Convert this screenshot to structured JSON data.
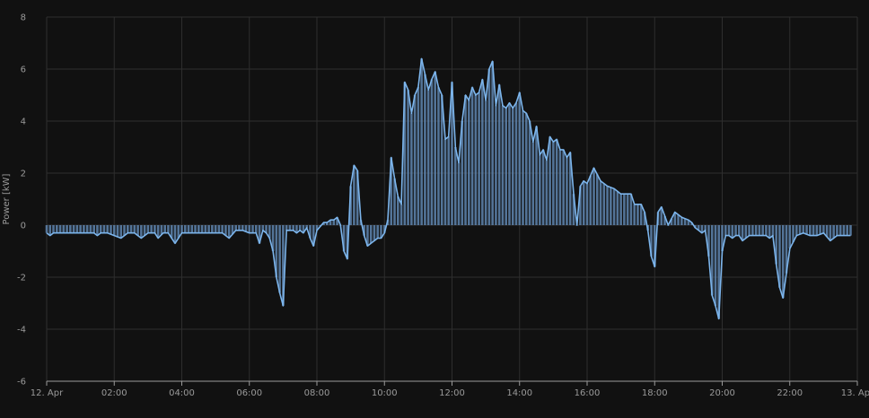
{
  "chart_data": {
    "type": "line",
    "title": "",
    "xlabel": "",
    "ylabel": "Power [kW]",
    "ylim": [
      -6,
      8
    ],
    "yticks": [
      -6,
      -4,
      -2,
      0,
      2,
      4,
      6,
      8
    ],
    "xlim": [
      0,
      24
    ],
    "xtick_labels": [
      "12. Apr",
      "02:00",
      "04:00",
      "06:00",
      "08:00",
      "10:00",
      "12:00",
      "14:00",
      "16:00",
      "18:00",
      "20:00",
      "22:00",
      "13. Apr"
    ],
    "xtick_hours": [
      0,
      2,
      4,
      6,
      8,
      10,
      12,
      14,
      16,
      18,
      20,
      22,
      24
    ],
    "grid": true,
    "colors": {
      "background": "#111111",
      "grid": "#2e2e2e",
      "line": "#7cb5ec",
      "bars": "#5f86b0"
    },
    "series": [
      {
        "x_hours": [
          0,
          0.1,
          0.2,
          0.4,
          0.6,
          0.8,
          1.0,
          1.2,
          1.4,
          1.5,
          1.6,
          1.8,
          2.0,
          2.2,
          2.4,
          2.6,
          2.8,
          3.0,
          3.2,
          3.3,
          3.45,
          3.6,
          3.8,
          4.0,
          4.2,
          4.4,
          4.6,
          4.8,
          5.0,
          5.2,
          5.4,
          5.6,
          5.8,
          6.0,
          6.1,
          6.2,
          6.3,
          6.4,
          6.5,
          6.6,
          6.7,
          6.8,
          6.9,
          7.0,
          7.1,
          7.2,
          7.3,
          7.4,
          7.5,
          7.6,
          7.7,
          7.8,
          7.9,
          8.0,
          8.2,
          8.3,
          8.4,
          8.5,
          8.6,
          8.7,
          8.8,
          8.9,
          9.0,
          9.1,
          9.2,
          9.3,
          9.4,
          9.5,
          9.6,
          9.7,
          9.8,
          9.9,
          10.0,
          10.1,
          10.2,
          10.3,
          10.4,
          10.5,
          10.6,
          10.7,
          10.8,
          10.9,
          11.0,
          11.1,
          11.2,
          11.3,
          11.4,
          11.5,
          11.6,
          11.7,
          11.8,
          11.9,
          12.0,
          12.1,
          12.2,
          12.3,
          12.4,
          12.5,
          12.6,
          12.7,
          12.8,
          12.9,
          13.0,
          13.1,
          13.2,
          13.3,
          13.4,
          13.5,
          13.6,
          13.7,
          13.8,
          13.9,
          14.0,
          14.1,
          14.2,
          14.3,
          14.4,
          14.5,
          14.6,
          14.7,
          14.8,
          14.9,
          15.0,
          15.1,
          15.2,
          15.3,
          15.4,
          15.5,
          15.6,
          15.7,
          15.8,
          15.9,
          16.0,
          16.2,
          16.4,
          16.6,
          16.8,
          17.0,
          17.1,
          17.2,
          17.3,
          17.4,
          17.5,
          17.6,
          17.7,
          17.8,
          17.9,
          18.0,
          18.1,
          18.2,
          18.4,
          18.6,
          18.8,
          19.0,
          19.1,
          19.2,
          19.3,
          19.4,
          19.5,
          19.6,
          19.7,
          19.8,
          19.9,
          20.0,
          20.1,
          20.2,
          20.3,
          20.4,
          20.5,
          20.6,
          20.8,
          21.0,
          21.2,
          21.3,
          21.4,
          21.5,
          21.6,
          21.7,
          21.8,
          22.0,
          22.2,
          22.4,
          22.6,
          22.8,
          23.0,
          23.2,
          23.4,
          23.6,
          23.7,
          23.8
        ],
        "values": [
          -0.3,
          -0.4,
          -0.3,
          -0.3,
          -0.3,
          -0.3,
          -0.3,
          -0.3,
          -0.3,
          -0.4,
          -0.3,
          -0.3,
          -0.4,
          -0.5,
          -0.3,
          -0.3,
          -0.5,
          -0.3,
          -0.3,
          -0.5,
          -0.3,
          -0.3,
          -0.7,
          -0.3,
          -0.3,
          -0.3,
          -0.3,
          -0.3,
          -0.3,
          -0.3,
          -0.5,
          -0.2,
          -0.2,
          -0.3,
          -0.3,
          -0.3,
          -0.7,
          -0.2,
          -0.3,
          -0.5,
          -1.0,
          -2.0,
          -2.6,
          -3.1,
          -0.2,
          -0.2,
          -0.2,
          -0.3,
          -0.2,
          -0.3,
          -0.1,
          -0.5,
          -0.8,
          -0.2,
          0.1,
          0.1,
          0.2,
          0.2,
          0.3,
          0.0,
          -1.0,
          -1.3,
          1.5,
          2.3,
          2.1,
          0.2,
          -0.4,
          -0.8,
          -0.7,
          -0.6,
          -0.5,
          -0.5,
          -0.3,
          0.2,
          2.6,
          1.8,
          1.1,
          0.8,
          5.5,
          5.2,
          4.3,
          5.0,
          5.3,
          6.4,
          5.8,
          5.2,
          5.6,
          5.9,
          5.3,
          5.0,
          3.3,
          3.4,
          5.5,
          3.0,
          2.4,
          4.0,
          5.0,
          4.8,
          5.3,
          5.0,
          5.1,
          5.6,
          4.8,
          6.0,
          6.3,
          4.6,
          5.4,
          4.6,
          4.5,
          4.7,
          4.5,
          4.7,
          5.1,
          4.4,
          4.3,
          4.0,
          3.2,
          3.8,
          2.7,
          2.9,
          2.5,
          3.4,
          3.2,
          3.3,
          2.9,
          2.9,
          2.6,
          2.8,
          1.2,
          0.0,
          1.5,
          1.7,
          1.6,
          2.2,
          1.7,
          1.5,
          1.4,
          1.2,
          1.2,
          1.2,
          1.2,
          0.8,
          0.8,
          0.8,
          0.5,
          -0.2,
          -1.2,
          -1.6,
          0.5,
          0.7,
          0.0,
          0.5,
          0.3,
          0.2,
          0.1,
          -0.1,
          -0.2,
          -0.3,
          -0.2,
          -1.2,
          -2.7,
          -3.1,
          -3.6,
          -1.0,
          -0.4,
          -0.4,
          -0.5,
          -0.4,
          -0.4,
          -0.6,
          -0.4,
          -0.4,
          -0.4,
          -0.4,
          -0.5,
          -0.4,
          -1.5,
          -2.4,
          -2.8,
          -0.9,
          -0.4,
          -0.3,
          -0.4,
          -0.4,
          -0.3,
          -0.6,
          -0.4,
          -0.4,
          -0.4,
          -0.4,
          -0.4,
          -0.4,
          -0.7,
          -0.4
        ]
      }
    ]
  }
}
